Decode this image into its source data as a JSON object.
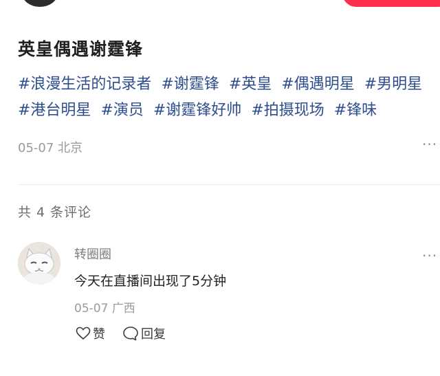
{
  "post": {
    "title": "英皇偶遇谢霆锋",
    "tags": [
      "#浪漫生活的记录者",
      "#谢霆锋",
      "#英皇",
      "#偶遇明星",
      "#男明星",
      "#港台明星",
      "#演员",
      "#谢霆锋好帅",
      "#拍摄现场",
      "#锋味"
    ],
    "date": "05-07",
    "location": "北京",
    "more_label": "···"
  },
  "comments": {
    "count_label": "共 4 条评论",
    "items": [
      {
        "author": "转圈圈",
        "text": "今天在直播间出现了5分钟",
        "date": "05-07",
        "location": "广西",
        "like_label": "赞",
        "reply_label": "回复",
        "more_label": "···"
      }
    ]
  },
  "icons": {
    "like": "heart-icon",
    "reply": "chat-bubble-icon",
    "more": "ellipsis-icon"
  },
  "colors": {
    "accent": "#ff2e4d",
    "tag": "#2e4d8f",
    "meta": "#9a9a9a"
  }
}
